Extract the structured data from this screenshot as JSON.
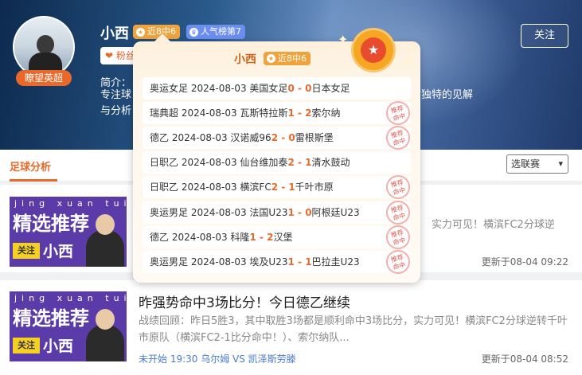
{
  "profile": {
    "name": "小西",
    "avatar_tag": "瞭望英超",
    "streak_badge": "近8中6",
    "rank_badge": "人气榜第7",
    "fans_label": "粉丝",
    "intro_label": "简介：",
    "intro_line1": "专注球",
    "intro_line1_right": "有独特的见解",
    "intro_line2": "与分析",
    "follow_button": "关注",
    "streak_icon": "star-icon",
    "rank_icon": "crown-icon"
  },
  "tabs": {
    "active": "足球分析"
  },
  "filter": {
    "selected": "选联赛",
    "caret": "▾"
  },
  "popup": {
    "name": "小西",
    "streak_badge": "近8中6",
    "matches": [
      {
        "league": "奥运女足",
        "date": "2024-08-03",
        "home": "美国女足",
        "hs": "0",
        "sep": " - ",
        "as": "0",
        "away": "日本女足",
        "hit": false
      },
      {
        "league": "瑞典超",
        "date": "2024-08-03",
        "home": "瓦斯特拉斯",
        "hs": "1",
        "sep": " - ",
        "as": "2",
        "away": "索尔纳",
        "hit": true
      },
      {
        "league": "德乙",
        "date": "2024-08-03",
        "home": "汉诺威96",
        "hs": "2",
        "sep": " - ",
        "as": "0",
        "away": "雷根斯堡",
        "hit": true
      },
      {
        "league": "日职乙",
        "date": "2024-08-03",
        "home": "仙台维加泰",
        "hs": "2",
        "sep": " - ",
        "as": "1",
        "away": "清水鼓动",
        "hit": false
      },
      {
        "league": "日职乙",
        "date": "2024-08-03",
        "home": "横滨FC",
        "hs": "2",
        "sep": " - ",
        "as": "1",
        "away": "千叶市原",
        "hit": true
      },
      {
        "league": "奥运男足",
        "date": "2024-08-03",
        "home": "法国U23",
        "hs": "1",
        "sep": " - ",
        "as": "0",
        "away": "阿根廷U23",
        "hit": true
      },
      {
        "league": "德乙",
        "date": "2024-08-03",
        "home": "科隆",
        "hs": "1",
        "sep": " - ",
        "as": "2",
        "away": "汉堡",
        "hit": true
      },
      {
        "league": "奥运男足",
        "date": "2024-08-03",
        "home": "埃及U23",
        "hs": "1",
        "sep": " - ",
        "as": "1",
        "away": "巴拉圭U23",
        "hit": true
      }
    ],
    "stamp_line1": "推荐",
    "stamp_line2": "命中"
  },
  "articles": [
    {
      "thumb_pinyin": "jing xuan tui jian",
      "thumb_big": "精选推荐",
      "thumb_follow": "关注",
      "thumb_name": "小西",
      "title": "",
      "summary": "实力可见！横滨FC2分球逆",
      "foot": "",
      "updated": "更新于08-04 09:22"
    },
    {
      "thumb_pinyin": "jing xuan tui jian",
      "thumb_big": "精选推荐",
      "thumb_follow": "关注",
      "thumb_name": "小西",
      "title": "昨强势命中3场比分！今日德乙继续",
      "summary": "战绩回顾：昨日5胜3，其中取胜3场都是顺利命中3场比分，实力可见！横滨FC2分球逆转千叶市原队（横滨FC2-1比分命中！）、索尔纳队...",
      "foot": "未开始 19:30 乌尔姆 VS 凯泽斯劳滕",
      "updated": "更新于08-04 08:52"
    }
  ]
}
